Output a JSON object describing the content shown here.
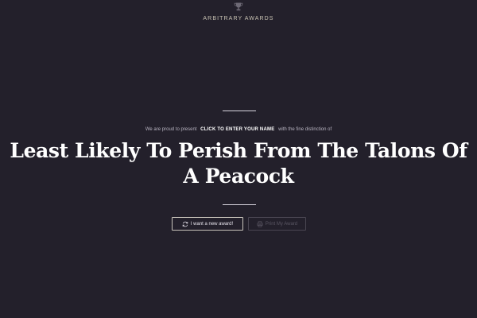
{
  "header": {
    "brand": "ARBITRARY AWARDS",
    "logo_icon": "trophy-icon"
  },
  "award": {
    "intro_before": "We are proud to present",
    "name_link": "CLICK TO ENTER YOUR NAME",
    "intro_after": "with the fine distinction of",
    "title": "Least Likely To Perish From The Talons Of A Peacock"
  },
  "actions": {
    "new_award_label": "I want a new award!",
    "new_award_icon": "refresh-icon",
    "print_label": "Print My Award",
    "print_icon": "printer-icon",
    "print_disabled": true
  },
  "colors": {
    "background": "#23202b",
    "text": "#ffffff",
    "brand_text": "#c9c3b4",
    "muted_button": "#5b5764"
  }
}
